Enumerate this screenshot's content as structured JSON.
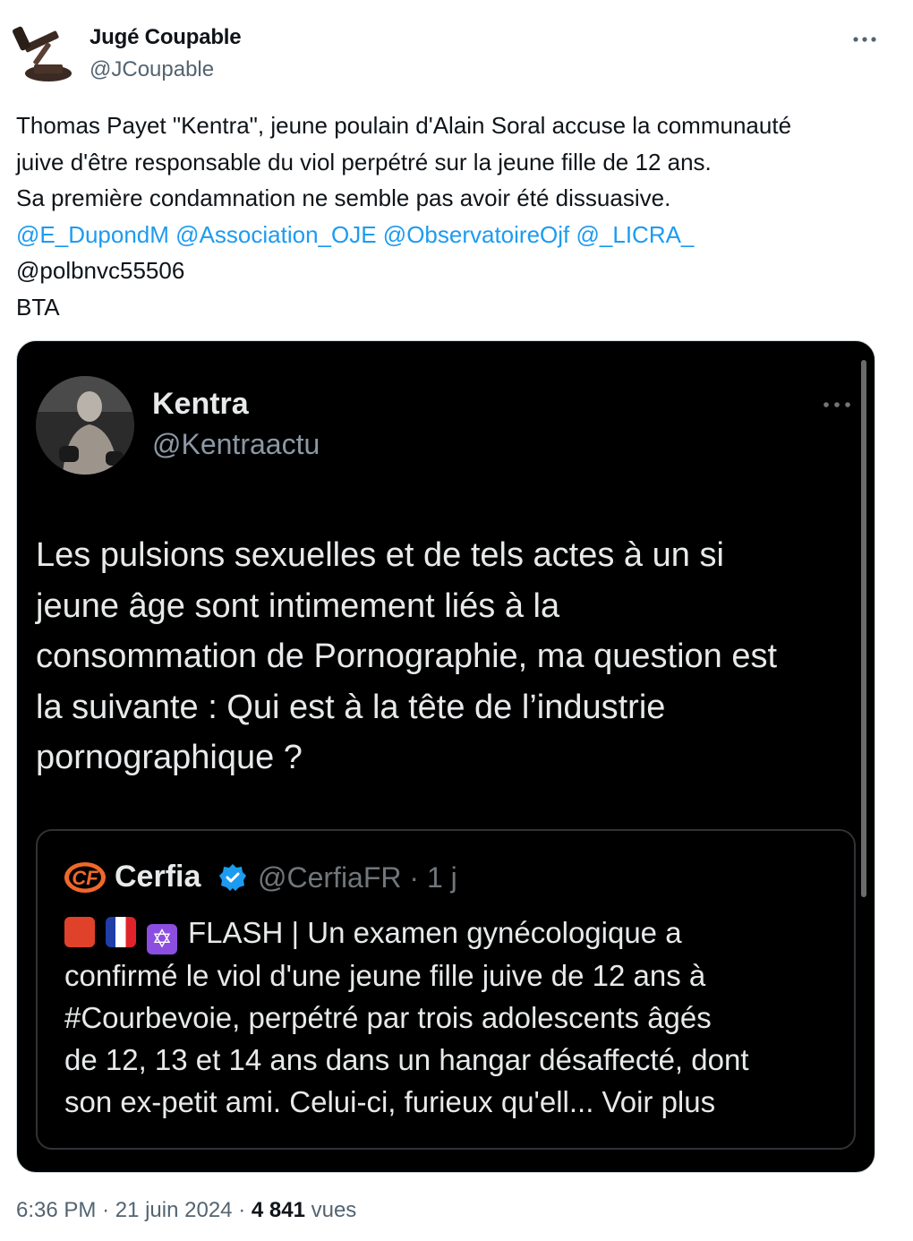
{
  "author": {
    "name": "Jugé Coupable",
    "handle": "@JCoupable"
  },
  "tweet": {
    "lines": [
      "Thomas Payet \"Kentra\", jeune poulain d'Alain Soral accuse la communauté",
      "juive d'être responsable du viol perpétré sur la jeune fille de 12 ans.",
      "Sa première condamnation ne semble pas avoir été dissuasive."
    ],
    "mentions": [
      "@E_DupondM",
      "@Association_OJE",
      "@ObservatoireOjf",
      "@_LICRA_"
    ],
    "plain_handle": "@polbnvc55506",
    "signature": "BTA"
  },
  "embedded": {
    "name": "Kentra",
    "handle": "@Kentraactu",
    "text_lines": [
      "Les pulsions sexuelles et de tels actes à un si",
      "jeune âge sont intimement liés à la",
      "consommation de Pornographie, ma question est",
      "la suivante : Qui est à la tête de l’industrie",
      "pornographique ?"
    ],
    "quote": {
      "logo": "CF",
      "name": "Cerfia",
      "handle": "@CerfiaFR",
      "separator": "·",
      "time": "1 j",
      "first_line": "FLASH | Un examen gynécologique a",
      "text_lines": [
        "confirmé le viol d'une jeune fille juive de 12 ans à",
        "#Courbevoie, perpétré par trois adolescents âgés",
        "de 12, 13 et 14 ans dans un hangar désaffecté, dont"
      ],
      "last_line": "son ex-petit ami. Celui-ci, furieux qu'ell...",
      "see_more": "Voir plus",
      "emojis": [
        "siren-emoji",
        "france-flag-emoji",
        "star-of-david-emoji"
      ]
    }
  },
  "footer": {
    "time": "6:36 PM",
    "sep1": "·",
    "date": "21 juin 2024",
    "sep2": "·",
    "views": "4 841",
    "views_label": "vues"
  },
  "colors": {
    "mention": "#1d9bf0",
    "verified": "#1d9bf0",
    "cerfia_orange": "#f0682a"
  }
}
